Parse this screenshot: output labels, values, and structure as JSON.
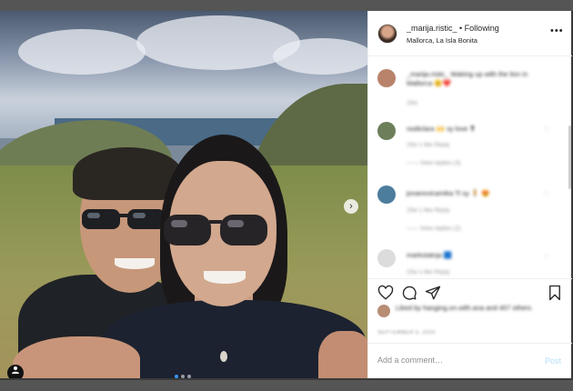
{
  "post": {
    "username": "_marija.ristic_",
    "follow_status": "• Following",
    "location": "Mallorca, La Isla Bonita",
    "more_glyph": "•••"
  },
  "photo": {
    "next_glyph": "›",
    "carousel_dots": 3,
    "active_dot": 1,
    "tag_glyph": "●"
  },
  "comments": [
    {
      "text": "_marija.ristic_ Waking up with the lion in Mallorca 😊❤️",
      "meta": "15w",
      "avatar_color": "#b9826a"
    },
    {
      "text": "nodiclara 🙌 sy love ❣",
      "meta": "15w  1 like  Reply",
      "replies": "—— View replies (3)",
      "avatar_color": "#6c7f5a"
    },
    {
      "text": "jovanovicamika Ti sy 🧍 😍",
      "meta": "15w  1 like  Reply",
      "replies": "—— View replies (2)",
      "avatar_color": "#4d7d9c"
    },
    {
      "text": "markstatnja 🟦",
      "meta": "15w  1 like  Reply",
      "avatar_color": "#dcdcdc"
    }
  ],
  "likes_text": "Liked by hanging.on.with.ana and 407 others",
  "date_text": "SEPTEMBER 5, 2020",
  "add_comment": {
    "placeholder": "Add a comment…",
    "post_label": "Post"
  },
  "colors": {
    "accent": "#3897f0",
    "post_disabled": "#b2dffc",
    "border": "#efefef"
  }
}
